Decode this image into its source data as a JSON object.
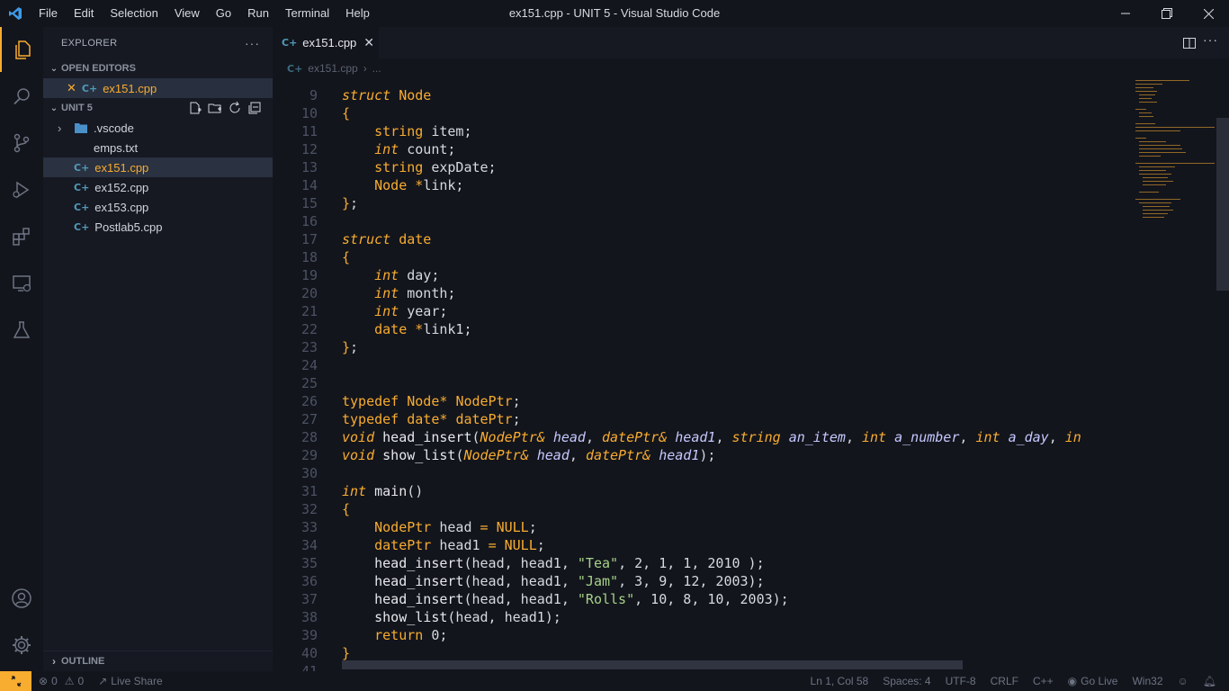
{
  "menu": [
    "File",
    "Edit",
    "Selection",
    "View",
    "Go",
    "Run",
    "Terminal",
    "Help"
  ],
  "window_title": "ex151.cpp - UNIT 5 - Visual Studio Code",
  "sidebar": {
    "title": "EXPLORER",
    "more": "···",
    "open_editors_label": "OPEN EDITORS",
    "open_editors": [
      {
        "icon": "cpp-icon",
        "label": "ex151.cpp"
      }
    ],
    "folder_label": "UNIT 5",
    "tree": [
      {
        "label": ".vscode",
        "kind": "folder"
      },
      {
        "label": "emps.txt",
        "kind": "txt"
      },
      {
        "label": "ex151.cpp",
        "kind": "cpp"
      },
      {
        "label": "ex152.cpp",
        "kind": "cpp"
      },
      {
        "label": "ex153.cpp",
        "kind": "cpp"
      },
      {
        "label": "Postlab5.cpp",
        "kind": "cpp"
      }
    ],
    "outline_label": "OUTLINE"
  },
  "tab": {
    "label": "ex151.cpp",
    "icon": "C++"
  },
  "breadcrumb": {
    "file": "ex151.cpp",
    "rest": "..."
  },
  "editor": {
    "lines": [
      {
        "n": "9",
        "t": "<span class=\"kw\">struct</span> <span class=\"ty\">Node</span>"
      },
      {
        "n": "10",
        "t": "<span class=\"ty\">{</span>"
      },
      {
        "n": "11",
        "t": "    <span class=\"ty\">string</span> item;"
      },
      {
        "n": "12",
        "t": "    <span class=\"kw\">int</span> count;"
      },
      {
        "n": "13",
        "t": "    <span class=\"ty\">string</span> expDate;"
      },
      {
        "n": "14",
        "t": "    <span class=\"ty\">Node</span> <span class=\"ty\">*</span>link;"
      },
      {
        "n": "15",
        "t": "<span class=\"ty\">}</span>;"
      },
      {
        "n": "16",
        "t": ""
      },
      {
        "n": "17",
        "t": "<span class=\"kw\">struct</span> <span class=\"ty\">date</span>"
      },
      {
        "n": "18",
        "t": "<span class=\"ty\">{</span>"
      },
      {
        "n": "19",
        "t": "    <span class=\"kw\">int</span> day;"
      },
      {
        "n": "20",
        "t": "    <span class=\"kw\">int</span> month;"
      },
      {
        "n": "21",
        "t": "    <span class=\"kw\">int</span> year;"
      },
      {
        "n": "22",
        "t": "    <span class=\"ty\">date</span> <span class=\"ty\">*</span>link1;"
      },
      {
        "n": "23",
        "t": "<span class=\"ty\">}</span>;"
      },
      {
        "n": "24",
        "t": ""
      },
      {
        "n": "25",
        "t": ""
      },
      {
        "n": "26",
        "t": "<span class=\"ty\">typedef</span> <span class=\"ty\">Node*</span> <span class=\"ty\">NodePtr</span>;"
      },
      {
        "n": "27",
        "t": "<span class=\"ty\">typedef</span> <span class=\"ty\">date*</span> <span class=\"ty\">datePtr</span>;"
      },
      {
        "n": "28",
        "t": "<span class=\"kw\">void</span> <span class=\"fn\">head_insert</span>(<span class=\"kw\">NodePtr&amp;</span> <span class=\"pa\">head</span>, <span class=\"kw\">datePtr&amp;</span> <span class=\"pa\">head1</span>, <span class=\"kw\">string</span> <span class=\"pa\">an_item</span>, <span class=\"kw\">int</span> <span class=\"pa\">a_number</span>, <span class=\"kw\">int</span> <span class=\"pa\">a_day</span>, <span class=\"kw\">in</span>"
      },
      {
        "n": "29",
        "t": "<span class=\"kw\">void</span> <span class=\"fn\">show_list</span>(<span class=\"kw\">NodePtr&amp;</span> <span class=\"pa\">head</span>, <span class=\"kw\">datePtr&amp;</span> <span class=\"pa\">head1</span>);"
      },
      {
        "n": "30",
        "t": ""
      },
      {
        "n": "31",
        "t": "<span class=\"kw\">int</span> <span class=\"fn\">main</span>()"
      },
      {
        "n": "32",
        "t": "<span class=\"ty\">{</span>"
      },
      {
        "n": "33",
        "t": "    <span class=\"ty\">NodePtr</span> head <span class=\"ty\">=</span> <span class=\"ty\">NULL</span>;"
      },
      {
        "n": "34",
        "t": "    <span class=\"ty\">datePtr</span> head1 <span class=\"ty\">=</span> <span class=\"ty\">NULL</span>;"
      },
      {
        "n": "35",
        "t": "    <span class=\"fn\">head_insert</span>(head, head1, <span class=\"st\">\"Tea\"</span>, 2, 1, 1, 2010 );"
      },
      {
        "n": "36",
        "t": "    <span class=\"fn\">head_insert</span>(head, head1, <span class=\"st\">\"Jam\"</span>, 3, 9, 12, 2003);"
      },
      {
        "n": "37",
        "t": "    <span class=\"fn\">head_insert</span>(head, head1, <span class=\"st\">\"Rolls\"</span>, 10, 8, 10, 2003);"
      },
      {
        "n": "38",
        "t": "    <span class=\"fn\">show_list</span>(head, head1);"
      },
      {
        "n": "39",
        "t": "    <span class=\"ty\">return</span> 0;"
      },
      {
        "n": "40",
        "t": "<span class=\"ty\">}</span>"
      },
      {
        "n": "41",
        "t": ""
      }
    ]
  },
  "status": {
    "errors": "0",
    "warnings": "0",
    "live_share": "Live Share",
    "position": "Ln 1, Col 58",
    "spaces": "Spaces: 4",
    "encoding": "UTF-8",
    "eol": "CRLF",
    "language": "C++",
    "go_live": "Go Live",
    "platform": "Win32"
  },
  "colors": {
    "accent": "#f8ac30",
    "background": "#13151c",
    "sidebar": "#161922"
  }
}
